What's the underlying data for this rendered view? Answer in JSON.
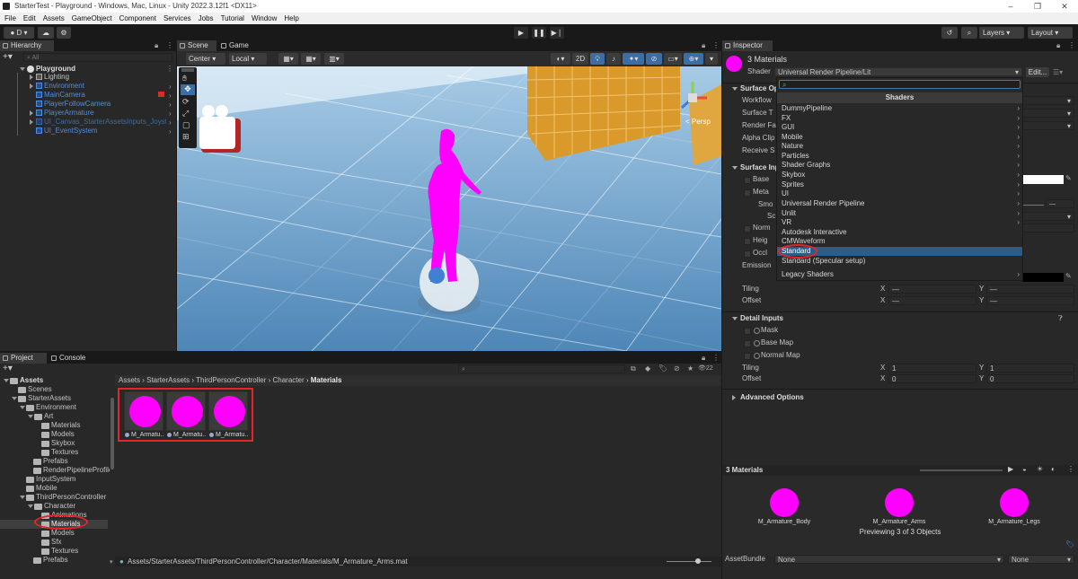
{
  "window": {
    "title": "StarterTest - Playground - Windows, Mac, Linux - Unity 2022.3.12f1 <DX11>"
  },
  "menu": [
    "File",
    "Edit",
    "Assets",
    "GameObject",
    "Component",
    "Services",
    "Jobs",
    "Tutorial",
    "Window",
    "Help"
  ],
  "toolbar": {
    "account": "D",
    "layers": "Layers",
    "layout": "Layout"
  },
  "hierarchy": {
    "tab": "Hierarchy",
    "search_placeholder": "All",
    "scene": "Playground",
    "items": [
      "Lighting",
      "Environment",
      "MainCamera",
      "PlayerFollowCamera",
      "PlayerArmature",
      "UI_Canvas_StarterAssetsInputs_Joystic",
      "UI_EventSystem"
    ]
  },
  "scene": {
    "tabs": [
      "Scene",
      "Game"
    ],
    "pivot": "Center",
    "space": "Local",
    "mode2d": "2D",
    "gizmo_label": "< Persp"
  },
  "project": {
    "tabs": [
      "Project",
      "Console"
    ],
    "hidden_count": "22",
    "breadcrumb": [
      "Assets",
      "StarterAssets",
      "ThirdPersonController",
      "Character",
      "Materials"
    ],
    "tree": [
      "Assets",
      "Scenes",
      "StarterAssets",
      "Environment",
      "Art",
      "Materials",
      "Models",
      "Skybox",
      "Textures",
      "Prefabs",
      "RenderPipelineProfile",
      "InputSystem",
      "Mobile",
      "ThirdPersonController",
      "Character",
      "Animations",
      "Materials",
      "Models",
      "Sfx",
      "Textures",
      "Prefabs"
    ],
    "assets": [
      "M_Armatu...",
      "M_Armatu...",
      "M_Armatu..."
    ],
    "status_path": "Assets/StarterAssets/ThirdPersonController/Character/Materials/M_Armature_Arms.mat"
  },
  "inspector": {
    "tab": "Inspector",
    "object_title": "3 Materials",
    "shader_label": "Shader",
    "shader_value": "Universal Render Pipeline/Lit",
    "edit_label": "Edit...",
    "sections": {
      "surface_options": "Surface Op",
      "surface_inputs": "Surface Inp",
      "detail_inputs": "Detail Inputs",
      "advanced": "Advanced Options"
    },
    "surface_option_labels": [
      "Workflow",
      "Surface T",
      "Render Fa",
      "Alpha Clip",
      "Receive S"
    ],
    "surface_input_labels": [
      "Base",
      "Meta",
      "Smo",
      "Sc",
      "Norm",
      "Heig",
      "Occl",
      "Emission"
    ],
    "tiling_label": "Tiling",
    "offset_label": "Offset",
    "x_label": "X",
    "y_label": "Y",
    "tiling_top": {
      "x": "—",
      "y": "—"
    },
    "offset_top": {
      "x": "—",
      "y": "—"
    },
    "detail_labels": [
      "Mask",
      "Base Map",
      "Normal Map"
    ],
    "tiling_detail": {
      "x": "1",
      "y": "1"
    },
    "offset_detail": {
      "x": "0",
      "y": "0"
    },
    "preview_title": "3 Materials",
    "preview_names": [
      "M_Armature_Body",
      "M_Armature_Arms",
      "M_Armature_Legs"
    ],
    "preview_caption": "Previewing 3 of 3 Objects",
    "assetbundle_label": "AssetBundle",
    "assetbundle_value": "None",
    "assetbundle_variant": "None"
  },
  "shader_dropdown": {
    "search_value": "",
    "header": "Shaders",
    "items": [
      {
        "label": "DummyPipeline",
        "submenu": true
      },
      {
        "label": "FX",
        "submenu": true
      },
      {
        "label": "GUI",
        "submenu": true
      },
      {
        "label": "Mobile",
        "submenu": true
      },
      {
        "label": "Nature",
        "submenu": true
      },
      {
        "label": "Particles",
        "submenu": true
      },
      {
        "label": "Shader Graphs",
        "submenu": true
      },
      {
        "label": "Skybox",
        "submenu": true
      },
      {
        "label": "Sprites",
        "submenu": true
      },
      {
        "label": "UI",
        "submenu": true
      },
      {
        "label": "Universal Render Pipeline",
        "submenu": true
      },
      {
        "label": "Unlit",
        "submenu": true
      },
      {
        "label": "VR",
        "submenu": true
      },
      {
        "label": "Autodesk Interactive",
        "submenu": false
      },
      {
        "label": "CMWaveform",
        "submenu": false
      },
      {
        "label": "Standard",
        "submenu": false,
        "selected": true
      },
      {
        "label": "Standard (Specular setup)",
        "submenu": false
      },
      {
        "label": "Legacy Shaders",
        "submenu": true
      }
    ]
  },
  "colors": {
    "accent": "#2c5d87",
    "magenta": "#ff00ff",
    "annotation": "#e8232b"
  }
}
